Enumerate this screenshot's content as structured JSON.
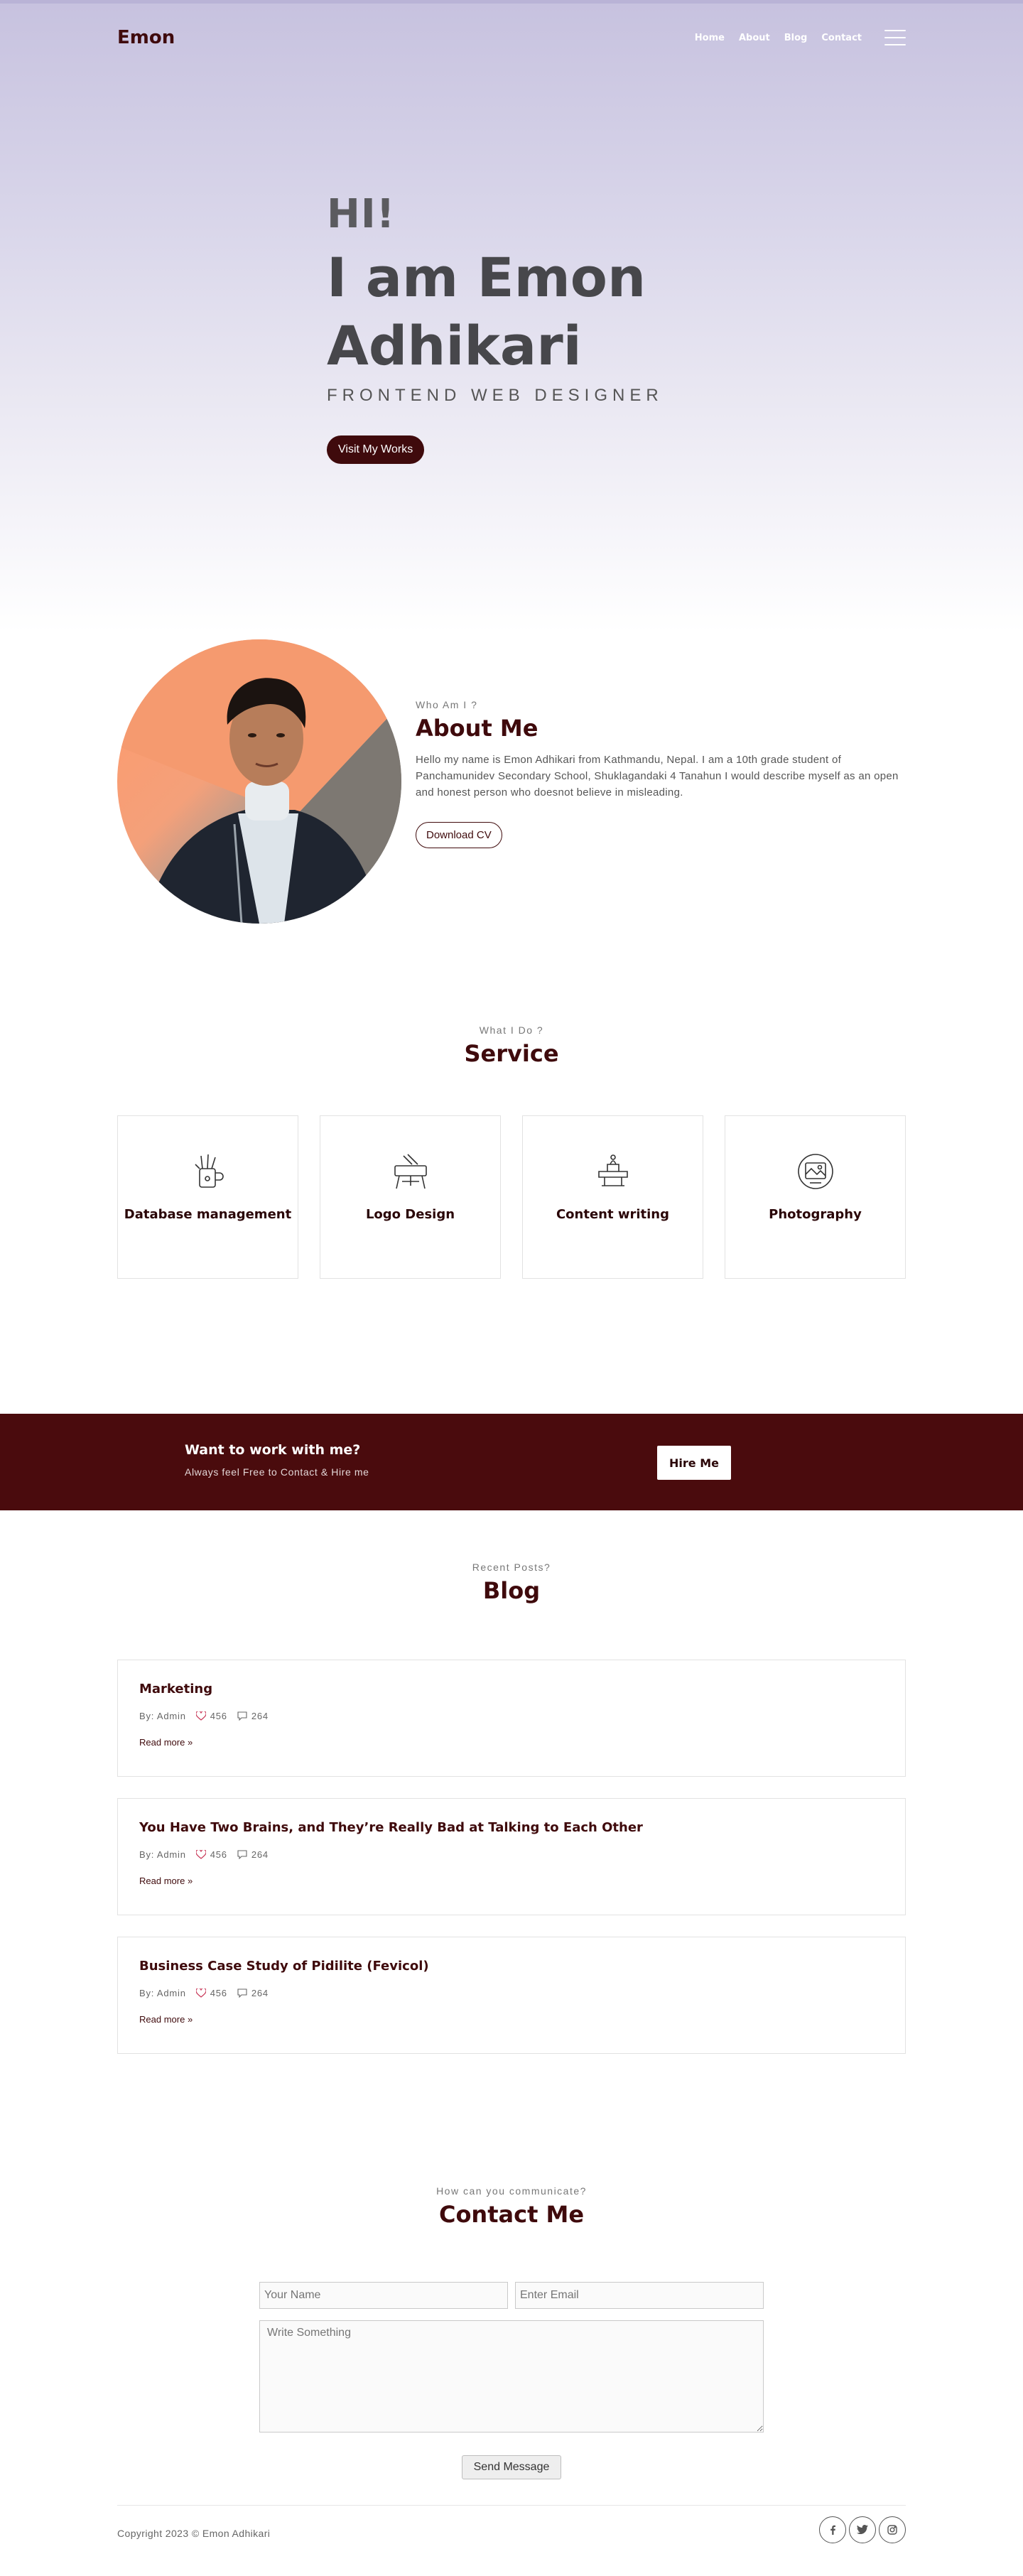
{
  "nav": {
    "brand": "Emon",
    "links": [
      "Home",
      "About",
      "Blog",
      "Contact"
    ]
  },
  "hero": {
    "greeting": "HI!",
    "name_line1": "I am Emon",
    "name_line2": "Adhikari",
    "role": "FRONTEND WEB DESIGNER",
    "cta": "Visit My Works"
  },
  "about": {
    "eyebrow": "Who Am I ?",
    "title": "About Me",
    "paragraph": "Hello my name is Emon Adhikari from Kathmandu, Nepal. I am a 10th grade student of Panchamunidev Secondary School, Shuklagandaki 4 Tanahun I would describe myself as an open and honest person who doesnot believe in misleading.",
    "cta": "Download CV"
  },
  "service": {
    "eyebrow": "What I Do ?",
    "title": "Service",
    "items": [
      {
        "label": "Database management",
        "icon": "pen-cup-icon"
      },
      {
        "label": "Logo Design",
        "icon": "drafting-table-icon"
      },
      {
        "label": "Content writing",
        "icon": "desk-lamp-icon"
      },
      {
        "label": "Photography",
        "icon": "camera-frame-icon"
      }
    ]
  },
  "hire": {
    "title": "Want to work with me?",
    "subtitle": "Always feel Free to Contact & Hire me",
    "button": "Hire Me"
  },
  "blog": {
    "eyebrow": "Recent Posts?",
    "title": "Blog",
    "posts": [
      {
        "title": "Marketing",
        "author": "By: Admin",
        "likes": "456",
        "comments": "264",
        "readmore": "Read more"
      },
      {
        "title": "You Have Two Brains, and They’re Really Bad at Talking to Each Other",
        "author": "By: Admin",
        "likes": "456",
        "comments": "264",
        "readmore": "Read more"
      },
      {
        "title": "Business Case Study of Pidilite (Fevicol)",
        "author": "By: Admin",
        "likes": "456",
        "comments": "264",
        "readmore": "Read more"
      }
    ]
  },
  "contact": {
    "eyebrow": "How can you communicate?",
    "title": "Contact Me",
    "name_placeholder": "Your Name",
    "email_placeholder": "Enter Email",
    "message_placeholder": "Write Something",
    "button": "Send Message"
  },
  "footer": {
    "copyright": "Copyright 2023 © Emon Adhikari",
    "socials": [
      "facebook-icon",
      "twitter-icon",
      "instagram-icon"
    ]
  },
  "colors": {
    "accent": "#3f0a0c",
    "hire_bg": "#4a0b0d",
    "hero_top": "#c7c2df"
  }
}
